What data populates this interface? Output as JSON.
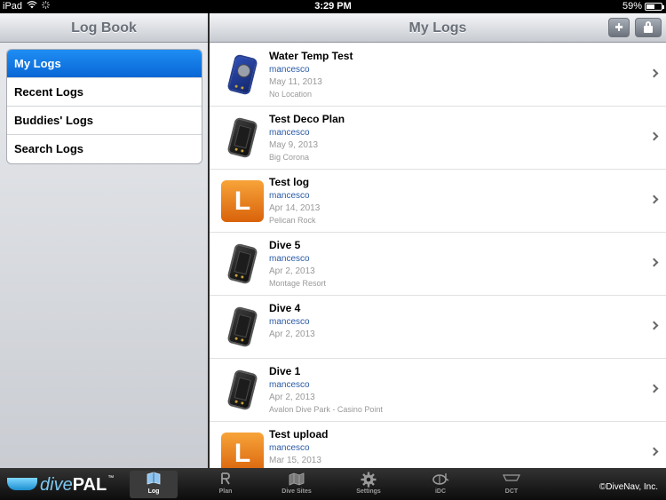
{
  "status": {
    "device": "iPad",
    "time": "3:29 PM",
    "battery": "59%",
    "battery_level": 0.59,
    "wifi_icon": "wifi-icon",
    "activity_icon": "spinner-icon"
  },
  "left_pane": {
    "title": "Log Book",
    "menu": [
      {
        "label": "My Logs",
        "selected": true
      },
      {
        "label": "Recent Logs"
      },
      {
        "label": "Buddies' Logs"
      },
      {
        "label": "Search Logs"
      }
    ]
  },
  "right_pane": {
    "title": "My Logs",
    "add_label": "+",
    "logs": [
      {
        "title": "Water Temp Test",
        "user": "mancesco",
        "date": "May 11, 2013",
        "location": "No Location",
        "thumb": "blue-device"
      },
      {
        "title": "Test Deco Plan",
        "user": "mancesco",
        "date": "May 9, 2013",
        "location": "Big Corona",
        "thumb": "black-device"
      },
      {
        "title": "Test log",
        "user": "mancesco",
        "date": "Apr 14, 2013",
        "location": "Pelican Rock",
        "thumb": "letter",
        "letter": "L"
      },
      {
        "title": "Dive 5",
        "user": "mancesco",
        "date": "Apr 2, 2013",
        "location": "Montage Resort",
        "thumb": "black-device"
      },
      {
        "title": "Dive 4",
        "user": "mancesco",
        "date": "Apr 2, 2013",
        "location": "",
        "thumb": "black-device"
      },
      {
        "title": "Dive 1",
        "user": "mancesco",
        "date": "Apr 2, 2013",
        "location": "Avalon Dive Park - Casino Point",
        "thumb": "black-device"
      },
      {
        "title": "Test upload",
        "user": "mancesco",
        "date": "Mar 15, 2013",
        "location": "",
        "thumb": "letter",
        "letter": "L"
      }
    ]
  },
  "tab_bar": {
    "brand_dive": "dive",
    "brand_pal": "PAL",
    "brand_tm": "™",
    "tabs": [
      {
        "label": "Log",
        "icon": "log-icon",
        "active": true
      },
      {
        "label": "Plan",
        "icon": "plan-icon"
      },
      {
        "label": "Dive Sites",
        "icon": "dive-sites-icon"
      },
      {
        "label": "Settings",
        "icon": "gear-icon"
      },
      {
        "label": "iDC",
        "icon": "dive-mask-icon"
      },
      {
        "label": "DCT",
        "icon": "dct-icon"
      }
    ],
    "copyright": "©DiveNav, Inc."
  },
  "colors": {
    "selected_blue": "#0a6fe0",
    "username_blue": "#2a5aa5",
    "thumb_orange": "#e8801f"
  }
}
